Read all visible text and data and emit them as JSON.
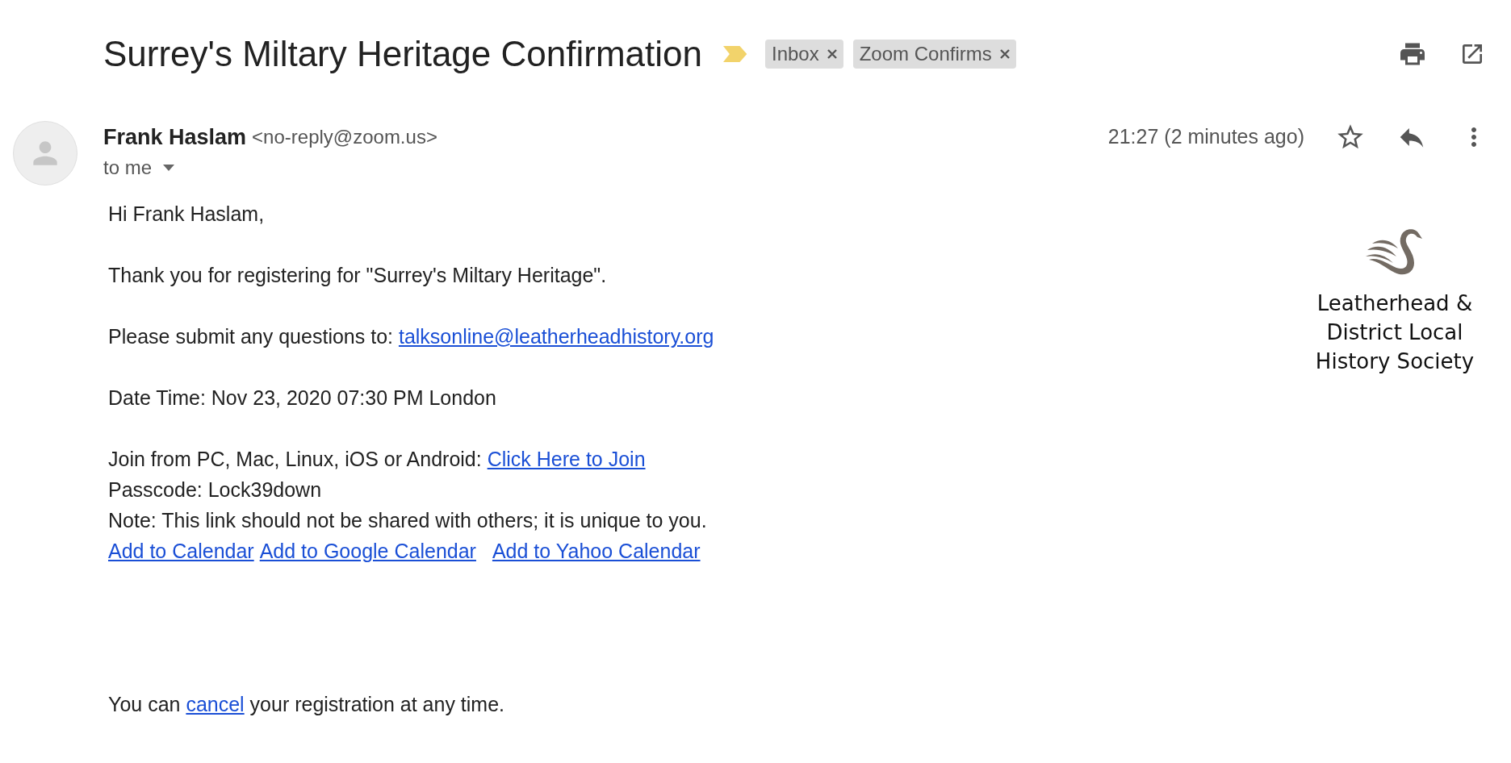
{
  "subject": "Surrey's Miltary Heritage Confirmation",
  "important": true,
  "labels": [
    {
      "text": "Inbox"
    },
    {
      "text": "Zoom Confirms"
    }
  ],
  "sender": {
    "name": "Frank Haslam",
    "email": "<no-reply@zoom.us>",
    "recipient": "to me",
    "time": "21:27 (2 minutes ago)",
    "starred": false
  },
  "body": [
    {
      "lines": [
        [
          {
            "kind": "text",
            "text": "Hi Frank Haslam,"
          }
        ]
      ]
    },
    {
      "lines": [
        [
          {
            "kind": "text",
            "text": "Thank you for registering for \"Surrey's Miltary Heritage\"."
          }
        ]
      ]
    },
    {
      "lines": [
        [
          {
            "kind": "text",
            "text": "Please submit any questions to: "
          },
          {
            "kind": "link",
            "text": "talksonline@leatherheadhistory.org"
          }
        ]
      ]
    },
    {
      "lines": [
        [
          {
            "kind": "text",
            "text": "Date Time: Nov 23, 2020 07:30 PM London"
          }
        ]
      ]
    },
    {
      "lines": [
        [
          {
            "kind": "text",
            "text": "Join from PC, Mac, Linux, iOS or Android: "
          },
          {
            "kind": "link",
            "text": "Click Here to Join"
          }
        ],
        [
          {
            "kind": "text",
            "text": "Passcode: Lock39down"
          }
        ],
        [
          {
            "kind": "text",
            "text": "Note: This link should not be shared with others; it is unique to you."
          }
        ],
        [
          {
            "kind": "link",
            "text": "Add to Calendar"
          },
          {
            "kind": "link",
            "text": "Add to Google Calendar"
          },
          {
            "kind": "link",
            "text": "Add to Yahoo Calendar"
          }
        ]
      ]
    }
  ],
  "footer": [
    {
      "kind": "text",
      "text": "You can "
    },
    {
      "kind": "link",
      "text": "cancel"
    },
    {
      "kind": "text",
      "text": " your registration at any time."
    }
  ],
  "logo": {
    "lines": [
      "Leatherhead &",
      "District Local",
      "History Society"
    ]
  }
}
